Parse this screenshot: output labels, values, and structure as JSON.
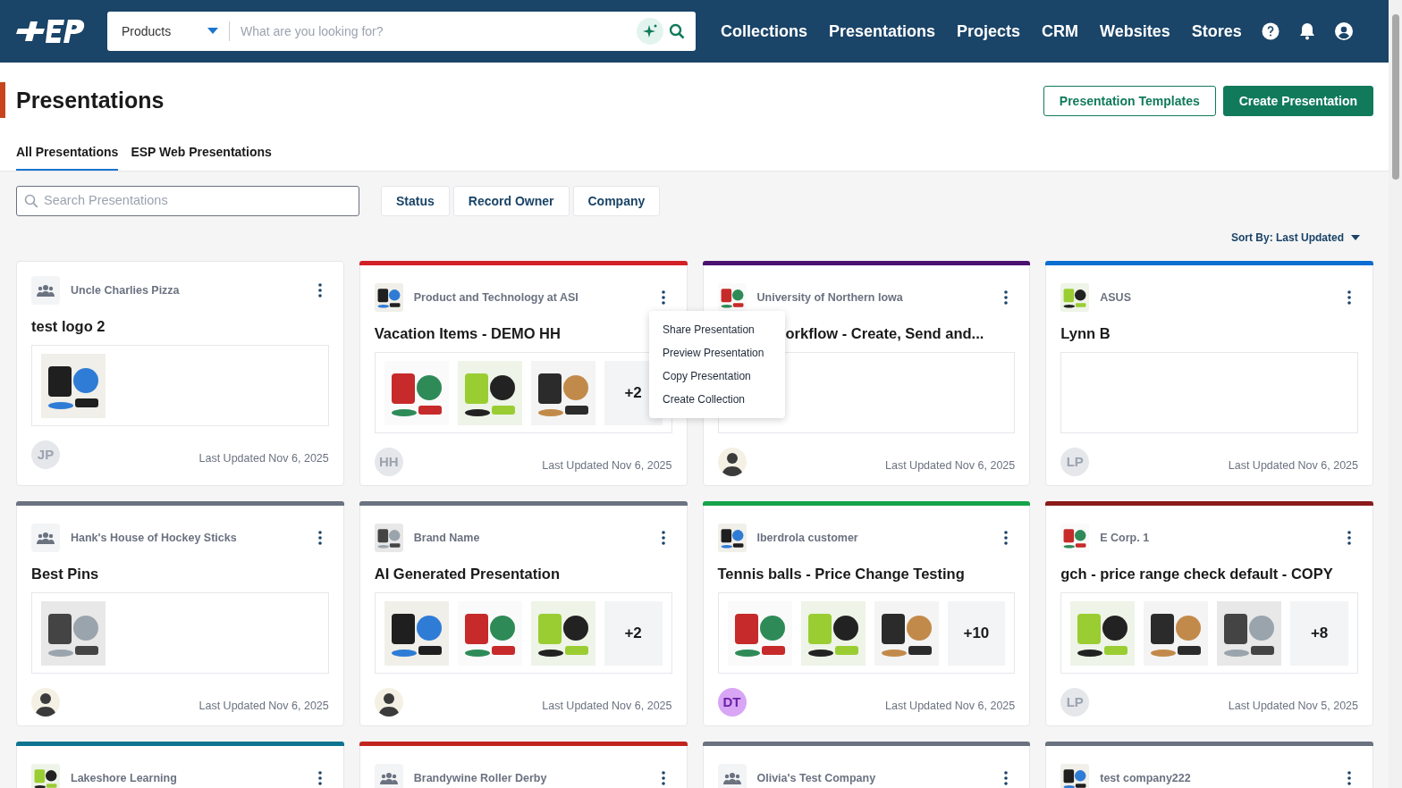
{
  "header": {
    "search": {
      "category": "Products",
      "placeholder": "What are you looking for?"
    },
    "nav": [
      "Collections",
      "Presentations",
      "Projects",
      "CRM",
      "Websites",
      "Stores"
    ]
  },
  "page": {
    "title": "Presentations",
    "buttons": [
      {
        "label": "Presentation Templates",
        "kind": "outline"
      },
      {
        "label": "Create Presentation",
        "kind": "primary"
      }
    ],
    "tabs": [
      {
        "label": "All Presentations",
        "selected": true
      },
      {
        "label": "ESP Web Presentations",
        "selected": false
      }
    ],
    "search": {
      "placeholder": "Search Presentations"
    },
    "filters": [
      "Status",
      "Record Owner",
      "Company"
    ],
    "sort": "Sort By: Last Updated"
  },
  "cards": [
    {
      "company": "Uncle Charlies Pizza",
      "logo": {
        "kind": "group"
      },
      "title": "test logo 2",
      "images": [
        {
          "kind": "picture"
        }
      ],
      "avatar": {
        "initials": "JP",
        "color": "#e5e7eb"
      },
      "updated": "Last Updated Nov 6, 2025"
    },
    {
      "company": "Product and Technology at ASI",
      "logo": {
        "kind": "picture"
      },
      "color": "#d32027",
      "title": "Vacation Items - DEMO HH",
      "images": [
        {
          "kind": "picture"
        },
        {
          "kind": "picture"
        },
        {
          "kind": "picture"
        }
      ],
      "more": "+2",
      "avatar": {
        "initials": "HH",
        "color": "#e5e7eb"
      },
      "updated": "Last Updated Nov 6, 2025",
      "menu": [
        "Share Presentation",
        "Preview Presentation",
        "Copy Presentation",
        "Create Collection"
      ]
    },
    {
      "company": "University of Northern Iowa",
      "logo": {
        "kind": "picture"
      },
      "color": "#4b116f",
      "title": "orkflow - Create, Send and...",
      "avatar": {
        "kind": "picture"
      },
      "updated": "Last Updated Nov 6, 2025"
    },
    {
      "company": "ASUS",
      "logo": {
        "kind": "picture"
      },
      "color": "#0a6fd1",
      "title": "Lynn B",
      "avatar": {
        "initials": "LP",
        "color": "#e5e7eb"
      },
      "updated": "Last Updated Nov 6, 2025"
    },
    {
      "company": "Hank's House of Hockey Sticks",
      "logo": {
        "kind": "group"
      },
      "color": "#6b7280",
      "title": "Best Pins",
      "images": [
        {
          "kind": "picture"
        }
      ],
      "avatar": {
        "kind": "picture"
      },
      "updated": "Last Updated Nov 6, 2025"
    },
    {
      "company": "Brand Name",
      "logo": {
        "kind": "picture"
      },
      "color": "#6b7280",
      "title": "AI Generated Presentation",
      "images": [
        {
          "kind": "picture"
        },
        {
          "kind": "picture"
        },
        {
          "kind": "picture"
        }
      ],
      "more": "+2",
      "avatar": {
        "kind": "picture"
      },
      "updated": "Last Updated Nov 6, 2025"
    },
    {
      "company": "Iberdrola customer",
      "logo": {
        "kind": "picture"
      },
      "color": "#16a34a",
      "title": "Tennis balls - Price Change Testing",
      "images": [
        {
          "kind": "picture"
        },
        {
          "kind": "picture"
        },
        {
          "kind": "picture"
        }
      ],
      "more": "+10",
      "avatar": {
        "initials": "DT",
        "color": "#d8a6f5"
      },
      "updated": "Last Updated Nov 6, 2025"
    },
    {
      "company": "E Corp. 1",
      "logo": {
        "kind": "picture"
      },
      "color": "#8b1a1a",
      "title": "gch - price range check default - COPY",
      "images": [
        {
          "kind": "picture"
        },
        {
          "kind": "picture"
        },
        {
          "kind": "picture"
        }
      ],
      "more": "+8",
      "avatar": {
        "initials": "LP",
        "color": "#e5e7eb"
      },
      "updated": "Last Updated Nov 5, 2025"
    },
    {
      "company": "Lakeshore Learning",
      "logo": {
        "kind": "picture"
      },
      "color": "#0e7490"
    },
    {
      "company": "Brandywine Roller Derby",
      "logo": {
        "kind": "group"
      },
      "color": "#c0261f"
    },
    {
      "company": "Olivia's Test Company",
      "logo": {
        "kind": "group"
      },
      "color": "#6b7280"
    },
    {
      "company": "test company222",
      "logo": {
        "kind": "picture"
      },
      "color": "#6b7280"
    }
  ]
}
